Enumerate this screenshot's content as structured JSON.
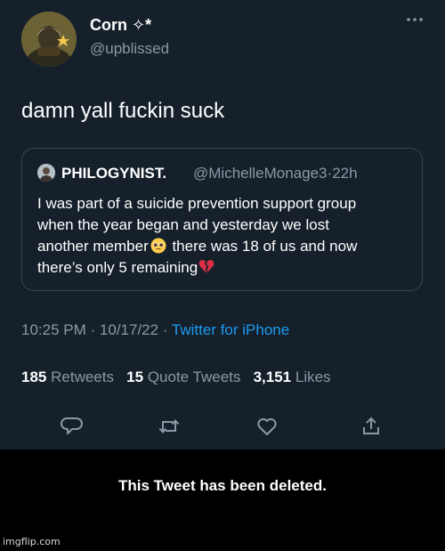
{
  "author": {
    "display_name": "Corn ✧*",
    "handle": "@upblissed",
    "avatar": "avatar-photo"
  },
  "tweet": {
    "text": "damn yall fuckin suck"
  },
  "quoted_tweet": {
    "name": "PHILOGYNIST.",
    "handle": "@MichelleMonage3",
    "time": "22h",
    "lines": {
      "l1": "I was part of a suicide prevention support group",
      "l2": "when the year began and yesterday we lost",
      "l3a": "another member",
      "l3b": " there was 18 of us and now",
      "l4": "there’s only 5 remaining"
    },
    "emojis": [
      "pleading-face-emoji",
      "broken-heart-emoji"
    ]
  },
  "meta": {
    "time": "10:25 PM",
    "date": "10/17/22",
    "separator": "·",
    "source": "Twitter for iPhone"
  },
  "stats": {
    "retweets_count": "185",
    "retweets_label": "Retweets",
    "quotes_count": "15",
    "quotes_label": "Quote Tweets",
    "likes_count": "3,151",
    "likes_label": "Likes"
  },
  "actions": [
    "reply-icon",
    "retweet-icon",
    "like-icon",
    "share-icon"
  ],
  "deleted_notice": "This Tweet has been deleted.",
  "watermark": "imgflip.com",
  "colors": {
    "background": "#15202b",
    "secondary_text": "#8b98a5",
    "link": "#1d9bf0",
    "border": "#38444d"
  }
}
